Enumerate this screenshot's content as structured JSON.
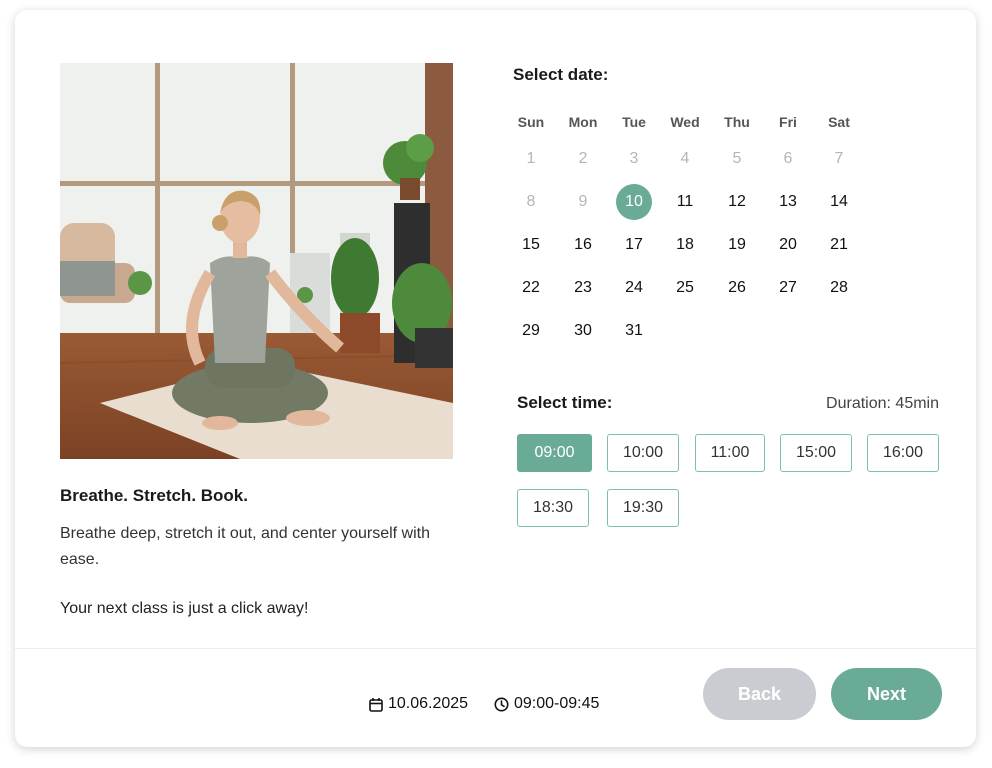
{
  "promo": {
    "title": "Breathe. Stretch. Book.",
    "text": "Breathe deep, stretch it out, and center yourself with ease.",
    "cta": "Your next class is just a click away!"
  },
  "calendar": {
    "heading": "Select date:",
    "weekdays": [
      "Sun",
      "Mon",
      "Tue",
      "Wed",
      "Thu",
      "Fri",
      "Sat"
    ],
    "weeks": [
      [
        "1",
        "2",
        "3",
        "4",
        "5",
        "6",
        "7"
      ],
      [
        "8",
        "9",
        "10",
        "11",
        "12",
        "13",
        "14"
      ],
      [
        "15",
        "16",
        "17",
        "18",
        "19",
        "20",
        "21"
      ],
      [
        "22",
        "23",
        "24",
        "25",
        "26",
        "27",
        "28"
      ],
      [
        "29",
        "30",
        "31"
      ]
    ],
    "disabled_days": [
      "1",
      "2",
      "3",
      "4",
      "5",
      "6",
      "7",
      "8",
      "9"
    ],
    "selected_day": "10"
  },
  "time": {
    "heading": "Select time:",
    "duration": "Duration: 45min",
    "slots": [
      "09:00",
      "10:00",
      "11:00",
      "15:00",
      "16:00",
      "18:30",
      "19:30"
    ],
    "selected_slot": "09:00"
  },
  "footer": {
    "date": "10.06.2025",
    "time_range": "09:00-09:45",
    "back_label": "Back",
    "next_label": "Next"
  },
  "colors": {
    "accent": "#6aab97",
    "slot_border": "#7cc1a9",
    "back_button": "#c9cdd1",
    "disabled_text": "#b5b5b5"
  },
  "icons": {
    "date": "calendar-icon",
    "time": "clock-icon"
  }
}
